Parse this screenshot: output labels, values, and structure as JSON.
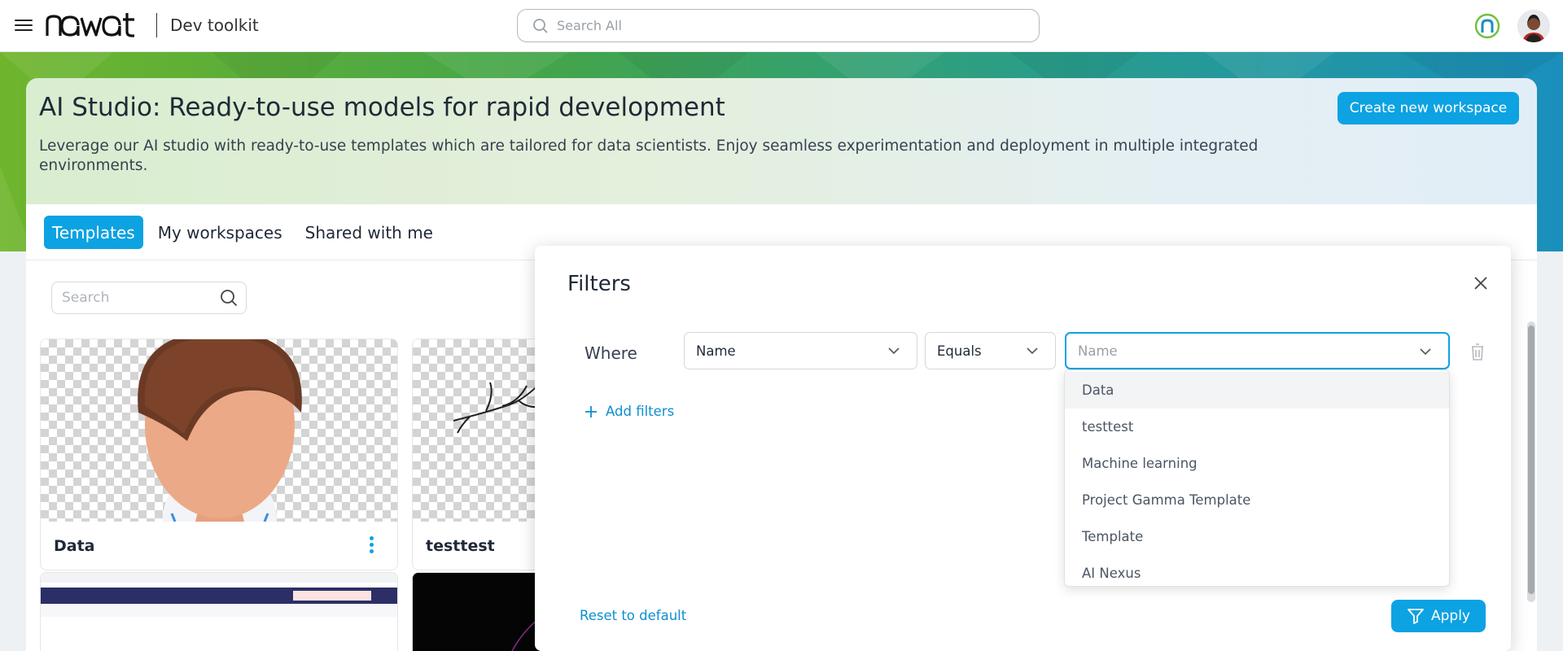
{
  "header": {
    "brand": "nawat",
    "product": "Dev toolkit",
    "search_placeholder": "Search All",
    "icons": [
      "menu-icon",
      "search-icon",
      "status-ring-icon",
      "user-avatar"
    ]
  },
  "hero": {
    "title": "AI Studio: Ready-to-use models for rapid development",
    "description": "Leverage our AI studio with ready-to-use templates which are tailored for data scientists. Enjoy seamless experimentation and deployment in multiple integrated environments.",
    "create_button": "Create new workspace"
  },
  "tabs": [
    {
      "label": "Templates",
      "active": true
    },
    {
      "label": "My workspaces",
      "active": false
    },
    {
      "label": "Shared with me",
      "active": false
    }
  ],
  "search": {
    "placeholder": "Search"
  },
  "cards": [
    {
      "name": "Data"
    },
    {
      "name": "testtest"
    }
  ],
  "filters": {
    "title": "Filters",
    "where_label": "Where",
    "field": "Name",
    "operator": "Equals",
    "value_placeholder": "Name",
    "add_filters": "Add filters",
    "reset": "Reset to default",
    "apply": "Apply",
    "options": [
      "Data",
      "testtest",
      "Machine learning",
      "Project Gamma Template",
      "Template",
      "AI Nexus"
    ],
    "highlighted_option": "Data"
  },
  "colors": {
    "accent": "#0da2e2",
    "link": "#0d8fcf",
    "band_start": "#6fb52c",
    "band_end": "#1a8fbd"
  }
}
